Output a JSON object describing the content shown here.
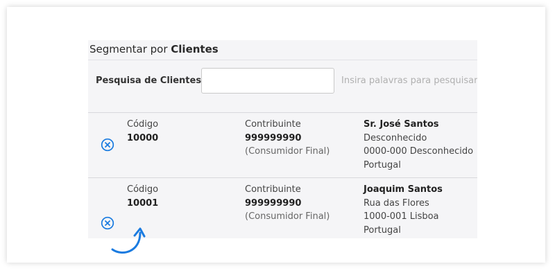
{
  "segment": {
    "title_prefix": "Segmentar por",
    "title_bold": "Clientes"
  },
  "search": {
    "label": "Pesquisa de Clientes",
    "value": "",
    "placeholder": "",
    "hint": "Insira palavras para pesquisar"
  },
  "clients": [
    {
      "code_label": "Código",
      "code": "10000",
      "taxpayer_label": "Contribuinte",
      "taxpayer": "999999990",
      "taxpayer_note": "(Consumidor Final)",
      "name": "Sr. José Santos",
      "address_line1": "Desconhecido",
      "address_line2": "0000-000 Desconhecido",
      "country": "Portugal"
    },
    {
      "code_label": "Código",
      "code": "10001",
      "taxpayer_label": "Contribuinte",
      "taxpayer": "999999990",
      "taxpayer_note": "(Consumidor Final)",
      "name": "Joaquim Santos",
      "address_line1": "Rua das Flores",
      "address_line2": "1000-001 Lisboa",
      "country": "Portugal"
    }
  ],
  "icons": {
    "remove": "remove-circle-icon",
    "annotation": "curved-arrow-icon"
  },
  "colors": {
    "accent": "#1a7be0",
    "panel_bg": "#f5f5f7"
  }
}
